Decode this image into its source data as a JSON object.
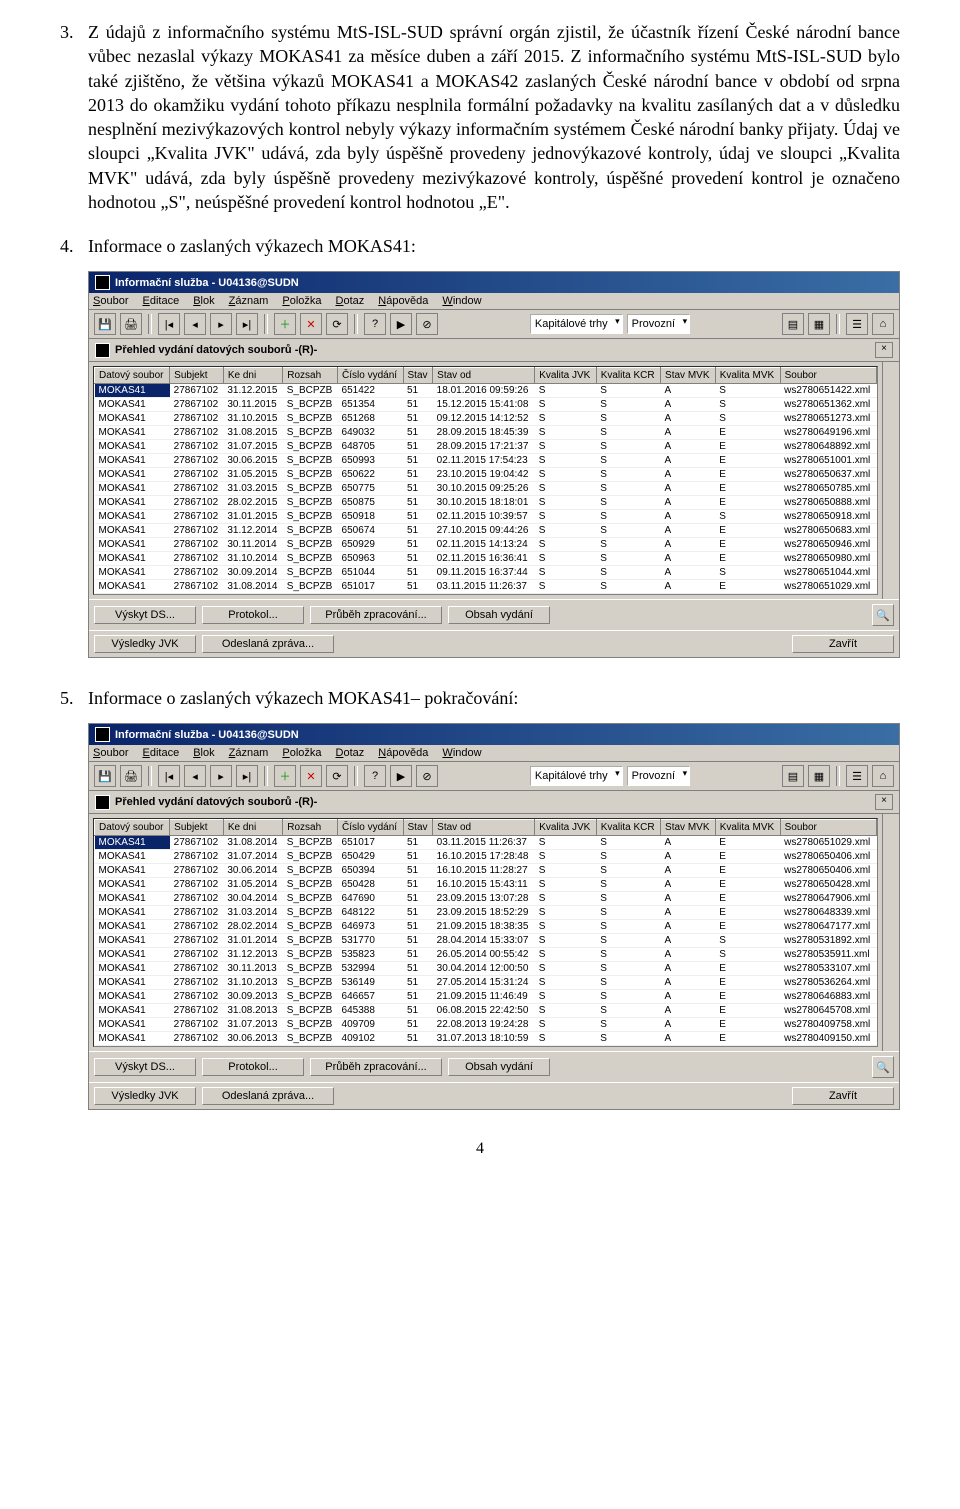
{
  "para3_num": "3.",
  "para3": "Z údajů z informačního systému MtS-ISL-SUD správní orgán zjistil, že účastník řízení České národní bance vůbec nezaslal výkazy MOKAS41 za měsíce duben a září 2015. Z informačního systému MtS-ISL-SUD bylo také zjištěno, že většina výkazů MOKAS41 a MOKAS42 zaslaných České národní bance v období od srpna 2013 do okamžiku vydání tohoto příkazu nesplnila formální požadavky na kvalitu zasílaných dat a v důsledku nesplnění mezivýkazových kontrol nebyly výkazy informačním systémem České národní banky přijaty. Údaj ve sloupci „Kvalita JVK\" udává, zda byly úspěšně provedeny jednovýkazové kontroly, údaj ve sloupci „Kvalita MVK\" udává, zda byly úspěšně provedeny mezivýkazové kontroly, úspěšné provedení kontrol je označeno hodnotou „S\", neúspěšné provedení kontrol hodnotou „E\".",
  "para4_num": "4.",
  "para4": "Informace o zaslaných výkazech MOKAS41:",
  "para5_num": "5.",
  "para5": "Informace o zaslaných výkazech MOKAS41– pokračování:",
  "page_number": "4",
  "app_title": "Informační služba - U04136@SUDN",
  "menus": [
    "Soubor",
    "Editace",
    "Blok",
    "Záznam",
    "Položka",
    "Dotaz",
    "Nápověda",
    "Window"
  ],
  "combo1": "Kapitálové trhy",
  "combo2": "Provozní",
  "subtitle": "Přehled vydání datových souborů -(R)-",
  "columns": [
    "Datový soubor",
    "Subjekt",
    "Ke dni",
    "Rozsah",
    "Číslo vydání",
    "Stav",
    "Stav od",
    "Kvalita JVK",
    "Kvalita KCR",
    "Stav MVK",
    "Kvalita MVK",
    "Soubor"
  ],
  "rows1": [
    [
      "MOKAS41",
      "27867102",
      "31.12.2015",
      "S_BCPZB",
      "651422",
      "51",
      "18.01.2016 09:59:26",
      "S",
      "S",
      "A",
      "S",
      "ws2780651422.xml"
    ],
    [
      "MOKAS41",
      "27867102",
      "30.11.2015",
      "S_BCPZB",
      "651354",
      "51",
      "15.12.2015 15:41:08",
      "S",
      "S",
      "A",
      "S",
      "ws2780651362.xml"
    ],
    [
      "MOKAS41",
      "27867102",
      "31.10.2015",
      "S_BCPZB",
      "651268",
      "51",
      "09.12.2015 14:12:52",
      "S",
      "S",
      "A",
      "S",
      "ws2780651273.xml"
    ],
    [
      "MOKAS41",
      "27867102",
      "31.08.2015",
      "S_BCPZB",
      "649032",
      "51",
      "28.09.2015 18:45:39",
      "S",
      "S",
      "A",
      "E",
      "ws2780649196.xml"
    ],
    [
      "MOKAS41",
      "27867102",
      "31.07.2015",
      "S_BCPZB",
      "648705",
      "51",
      "28.09.2015 17:21:37",
      "S",
      "S",
      "A",
      "E",
      "ws2780648892.xml"
    ],
    [
      "MOKAS41",
      "27867102",
      "30.06.2015",
      "S_BCPZB",
      "650993",
      "51",
      "02.11.2015 17:54:23",
      "S",
      "S",
      "A",
      "E",
      "ws2780651001.xml"
    ],
    [
      "MOKAS41",
      "27867102",
      "31.05.2015",
      "S_BCPZB",
      "650622",
      "51",
      "23.10.2015 19:04:42",
      "S",
      "S",
      "A",
      "E",
      "ws2780650637.xml"
    ],
    [
      "MOKAS41",
      "27867102",
      "31.03.2015",
      "S_BCPZB",
      "650775",
      "51",
      "30.10.2015 09:25:26",
      "S",
      "S",
      "A",
      "E",
      "ws2780650785.xml"
    ],
    [
      "MOKAS41",
      "27867102",
      "28.02.2015",
      "S_BCPZB",
      "650875",
      "51",
      "30.10.2015 18:18:01",
      "S",
      "S",
      "A",
      "E",
      "ws2780650888.xml"
    ],
    [
      "MOKAS41",
      "27867102",
      "31.01.2015",
      "S_BCPZB",
      "650918",
      "51",
      "02.11.2015 10:39:57",
      "S",
      "S",
      "A",
      "S",
      "ws2780650918.xml"
    ],
    [
      "MOKAS41",
      "27867102",
      "31.12.2014",
      "S_BCPZB",
      "650674",
      "51",
      "27.10.2015 09:44:26",
      "S",
      "S",
      "A",
      "E",
      "ws2780650683.xml"
    ],
    [
      "MOKAS41",
      "27867102",
      "30.11.2014",
      "S_BCPZB",
      "650929",
      "51",
      "02.11.2015 14:13:24",
      "S",
      "S",
      "A",
      "E",
      "ws2780650946.xml"
    ],
    [
      "MOKAS41",
      "27867102",
      "31.10.2014",
      "S_BCPZB",
      "650963",
      "51",
      "02.11.2015 16:36:41",
      "S",
      "S",
      "A",
      "E",
      "ws2780650980.xml"
    ],
    [
      "MOKAS41",
      "27867102",
      "30.09.2014",
      "S_BCPZB",
      "651044",
      "51",
      "09.11.2015 16:37:44",
      "S",
      "S",
      "A",
      "S",
      "ws2780651044.xml"
    ],
    [
      "MOKAS41",
      "27867102",
      "31.08.2014",
      "S_BCPZB",
      "651017",
      "51",
      "03.11.2015 11:26:37",
      "S",
      "S",
      "A",
      "E",
      "ws2780651029.xml"
    ]
  ],
  "rows2": [
    [
      "MOKAS41",
      "27867102",
      "31.08.2014",
      "S_BCPZB",
      "651017",
      "51",
      "03.11.2015 11:26:37",
      "S",
      "S",
      "A",
      "E",
      "ws2780651029.xml"
    ],
    [
      "MOKAS41",
      "27867102",
      "31.07.2014",
      "S_BCPZB",
      "650429",
      "51",
      "16.10.2015 17:28:48",
      "S",
      "S",
      "A",
      "E",
      "ws2780650406.xml"
    ],
    [
      "MOKAS41",
      "27867102",
      "30.06.2014",
      "S_BCPZB",
      "650394",
      "51",
      "16.10.2015 11:28:27",
      "S",
      "S",
      "A",
      "E",
      "ws2780650406.xml"
    ],
    [
      "MOKAS41",
      "27867102",
      "31.05.2014",
      "S_BCPZB",
      "650428",
      "51",
      "16.10.2015 15:43:11",
      "S",
      "S",
      "A",
      "E",
      "ws2780650428.xml"
    ],
    [
      "MOKAS41",
      "27867102",
      "30.04.2014",
      "S_BCPZB",
      "647690",
      "51",
      "23.09.2015 13:07:28",
      "S",
      "S",
      "A",
      "E",
      "ws2780647906.xml"
    ],
    [
      "MOKAS41",
      "27867102",
      "31.03.2014",
      "S_BCPZB",
      "648122",
      "51",
      "23.09.2015 18:52:29",
      "S",
      "S",
      "A",
      "E",
      "ws2780648339.xml"
    ],
    [
      "MOKAS41",
      "27867102",
      "28.02.2014",
      "S_BCPZB",
      "646973",
      "51",
      "21.09.2015 18:38:35",
      "S",
      "S",
      "A",
      "E",
      "ws2780647177.xml"
    ],
    [
      "MOKAS41",
      "27867102",
      "31.01.2014",
      "S_BCPZB",
      "531770",
      "51",
      "28.04.2014 15:33:07",
      "S",
      "S",
      "A",
      "S",
      "ws2780531892.xml"
    ],
    [
      "MOKAS41",
      "27867102",
      "31.12.2013",
      "S_BCPZB",
      "535823",
      "51",
      "26.05.2014 00:55:42",
      "S",
      "S",
      "A",
      "S",
      "ws2780535911.xml"
    ],
    [
      "MOKAS41",
      "27867102",
      "30.11.2013",
      "S_BCPZB",
      "532994",
      "51",
      "30.04.2014 12:00:50",
      "S",
      "S",
      "A",
      "E",
      "ws2780533107.xml"
    ],
    [
      "MOKAS41",
      "27867102",
      "31.10.2013",
      "S_BCPZB",
      "536149",
      "51",
      "27.05.2014 15:31:24",
      "S",
      "S",
      "A",
      "E",
      "ws2780536264.xml"
    ],
    [
      "MOKAS41",
      "27867102",
      "30.09.2013",
      "S_BCPZB",
      "646657",
      "51",
      "21.09.2015 11:46:49",
      "S",
      "S",
      "A",
      "E",
      "ws2780646883.xml"
    ],
    [
      "MOKAS41",
      "27867102",
      "31.08.2013",
      "S_BCPZB",
      "645388",
      "51",
      "06.08.2015 22:42:50",
      "S",
      "S",
      "A",
      "E",
      "ws2780645708.xml"
    ],
    [
      "MOKAS41",
      "27867102",
      "31.07.2013",
      "S_BCPZB",
      "409709",
      "51",
      "22.08.2013 19:24:28",
      "S",
      "S",
      "A",
      "E",
      "ws2780409758.xml"
    ],
    [
      "MOKAS41",
      "27867102",
      "30.06.2013",
      "S_BCPZB",
      "409102",
      "51",
      "31.07.2013 18:10:59",
      "S",
      "S",
      "A",
      "E",
      "ws2780409150.xml"
    ]
  ],
  "btn_vykyt": "Výskyt DS...",
  "btn_protokol": "Protokol...",
  "btn_prubeh": "Průběh zpracování...",
  "btn_obsah": "Obsah vydání",
  "btn_vysledky": "Výsledky JVK",
  "btn_odeslana": "Odeslaná zpráva...",
  "btn_zavrit": "Zavřít"
}
